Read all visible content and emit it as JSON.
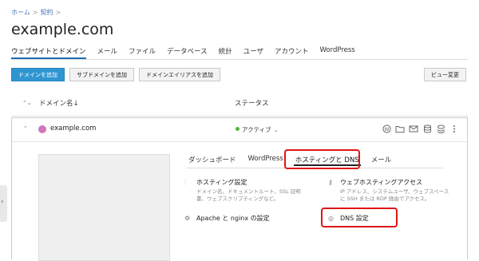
{
  "breadcrumb": {
    "home": "ホーム",
    "sep": ">",
    "contract": "契約",
    "sep2": ">"
  },
  "page_title": "example.com",
  "tabs": [
    {
      "label": "ウェブサイトとドメイン",
      "active": true
    },
    {
      "label": "メール"
    },
    {
      "label": "ファイル"
    },
    {
      "label": "データベース"
    },
    {
      "label": "統計"
    },
    {
      "label": "ユーザ"
    },
    {
      "label": "アカウント"
    },
    {
      "label": "WordPress"
    }
  ],
  "buttons": {
    "add_domain": "ドメインを追加",
    "add_subdomain": "サブドメインを追加",
    "add_alias": "ドメインエイリアスを追加",
    "view_change": "ビュー変更"
  },
  "table": {
    "sort_icon": "⌃⌄",
    "col_name": "ドメイン名↓",
    "col_status": "ステータス"
  },
  "domain_row": {
    "caret": "⌃",
    "name": "example.com",
    "status": "アクティブ",
    "status_chevron": "⌄",
    "status_color": "#58b43f",
    "tool_icons": [
      "wordpress-icon",
      "folder-icon",
      "mail-icon",
      "database-icon",
      "stack-icon",
      "more-icon"
    ]
  },
  "subtabs": [
    {
      "label": "ダッシュボード"
    },
    {
      "label": "WordPress"
    },
    {
      "label": "ホスティングと DNS",
      "active": true
    },
    {
      "label": "メール"
    }
  ],
  "features": {
    "hosting_settings": {
      "title": "ホスティング設定",
      "desc_line1": "ドメイン名、ドキュメントルート、SSL 証明",
      "desc_line2": "書、ウェブスクリプティングなど。"
    },
    "web_hosting_access": {
      "title": "ウェブホスティングアクセス",
      "desc_line1": "IP アドレス、システムユーザ、ウェブスペース",
      "desc_line2": "に SSH または RDP 経由でアクセス。"
    },
    "apache_nginx": {
      "title": "Apache と nginx の設定"
    },
    "dns_settings": {
      "title": "DNS 設定"
    }
  },
  "highlight_color": "#e01515",
  "accent_color": "#2f95d2"
}
